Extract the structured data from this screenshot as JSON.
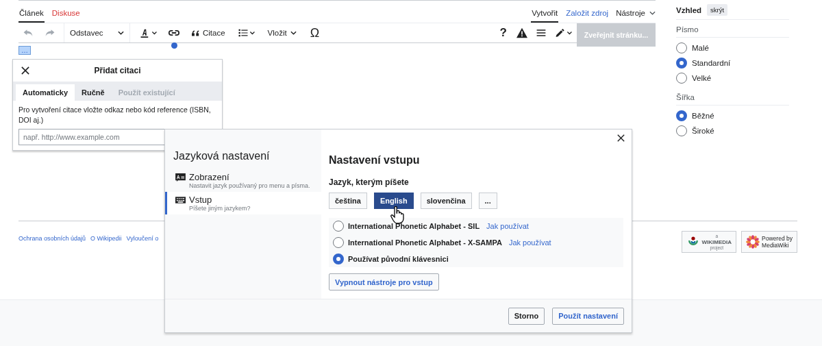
{
  "page_tabs": [
    {
      "label": "Článek",
      "selected": true,
      "missing": false
    },
    {
      "label": "Diskuse",
      "selected": false,
      "missing": true
    }
  ],
  "actions": [
    {
      "label": "Vytvořit",
      "selected": true
    },
    {
      "label": "Založit zdroj",
      "selected": false
    }
  ],
  "tools_menu": "Nástroje",
  "toolbar": {
    "undo_disabled": true,
    "redo_disabled": true,
    "paragraph": "Odstavec",
    "cite": "Citace",
    "insert": "Vložit",
    "special_chars": "Ω",
    "help": "?",
    "publish": {
      "label": "Zveřejnit stránku...",
      "disabled": true
    }
  },
  "reference_marker": "…",
  "cite_popup": {
    "title": "Přidat citaci",
    "tabs": [
      {
        "label": "Automaticky",
        "selected": true,
        "disabled": false
      },
      {
        "label": "Ručně",
        "selected": false,
        "disabled": false
      },
      {
        "label": "Použít existující",
        "selected": false,
        "disabled": true
      }
    ],
    "hint": "Pro vytvoření citace vložte odkaz nebo kód reference (ISBN, DOI aj.)",
    "placeholder": "např. http://www.example.com"
  },
  "appearance": {
    "title": "Vzhled",
    "hide": "skrýt",
    "groups": [
      {
        "label": "Písmo",
        "options": [
          {
            "label": "Malé",
            "selected": false
          },
          {
            "label": "Standardní",
            "selected": true
          },
          {
            "label": "Velké",
            "selected": false
          }
        ]
      },
      {
        "label": "Šířka",
        "options": [
          {
            "label": "Běžné",
            "selected": true
          },
          {
            "label": "Široké",
            "selected": false
          }
        ]
      }
    ]
  },
  "footer_links": [
    "Ochrana osobních údajů",
    "O Wikipedii",
    "Vyloučení o"
  ],
  "footer_badges": [
    {
      "kind": "wikimedia",
      "top": "a",
      "name": "WIKIMEDIA",
      "sub": "project"
    },
    {
      "kind": "mediawiki",
      "top": "Powered by",
      "name": "MediaWiki"
    }
  ],
  "dialog": {
    "title": "Jazyková nastavení",
    "nav": [
      {
        "kind": "display",
        "label": "Zobrazení",
        "description": "Nastavit jazyk používaný pro menu a písma.",
        "selected": false
      },
      {
        "kind": "input",
        "label": "Vstup",
        "description": "Píšete jiným jazykem?",
        "selected": true
      }
    ],
    "heading": "Nastavení vstupu",
    "subheading": "Jazyk, kterým píšete",
    "languages": [
      {
        "label": "čeština",
        "selected": false
      },
      {
        "label": "English",
        "selected": true
      },
      {
        "label": "slovenčina",
        "selected": false
      },
      {
        "label": "...",
        "selected": false
      }
    ],
    "methods": [
      {
        "label": "International Phonetic Alphabet - SIL",
        "link": "Jak používat",
        "selected": false
      },
      {
        "label": "International Phonetic Alphabet - X-SAMPA",
        "link": "Jak používat",
        "selected": false
      },
      {
        "label": "Používat původní klávesnici",
        "selected": true
      }
    ],
    "disable_button": "Vypnout nástroje pro vstup",
    "cancel": "Storno",
    "apply": "Použít nastavení"
  }
}
